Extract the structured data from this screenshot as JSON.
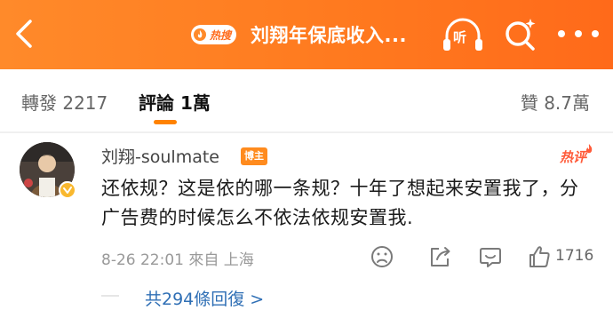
{
  "header": {
    "hot_badge": "热搜",
    "title": "刘翔年保底收入...",
    "listen_label": "听"
  },
  "tabs": {
    "repost_label": "轉發",
    "repost_count": "2217",
    "comments_label": "評論",
    "comments_count": "1萬",
    "likes_label": "贊",
    "likes_count": "8.7萬"
  },
  "comment": {
    "username": "刘翔-soulmate",
    "badge": "博主",
    "hot_label": "热评",
    "text": "还依规？这是依的哪一条规？十年了想起来安置我了，分广告费的时候怎么不依法依规安置我.",
    "date": "8-26 22:01",
    "location": "來自 上海",
    "like_count": "1716",
    "replies_link": "共294條回復 >"
  },
  "colors": {
    "header_bg": "#ff7a1f",
    "accent": "#ff8200",
    "link": "#2f6fb5"
  }
}
